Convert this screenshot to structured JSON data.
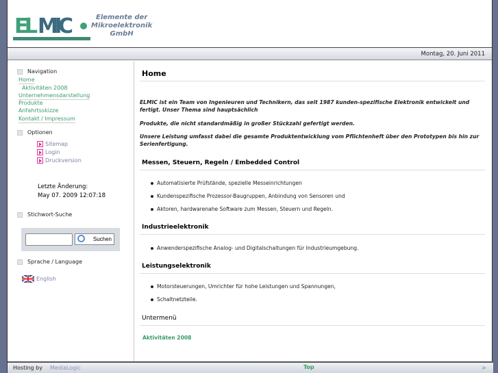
{
  "header": {
    "logo": "ELMIC",
    "tagline": [
      "Elemente der",
      "Mikroelektronik",
      "GmbH"
    ],
    "date": "Montag, 20. Juni 2011"
  },
  "sidebar": {
    "navigation_title": "Navigation",
    "nav": [
      "Home",
      "Aktivitäten 2008",
      "Unternehmensdarstellung",
      "Produkte",
      "Anfahrtsskizze",
      "Kontakt / Impressum"
    ],
    "options_title": "Optionen",
    "options": [
      "Sitemap",
      "Login",
      "Druckversion"
    ],
    "last_change_label": "Letzte Änderung:",
    "last_change": "May 07. 2009 12:07:18",
    "search_title": "Stichwort-Suche",
    "search_value": "",
    "search_button": "Suchen",
    "language_title": "Sprache / Language",
    "language": "English"
  },
  "main": {
    "title": "Home",
    "intro": [
      "ELMIC ist ein Team von Ingenieuren und Technikern, das seit 1987 kunden-spezifische Elektronik entwickelt und fertigt. Unser Thema sind hauptsächlich",
      "Produkte, die nicht standardmäßig in großer Stückzahl gefertigt werden.",
      "Unsere Leistung umfasst dabei die gesamte Produktentwicklung vom Pflichtenheft über den Prototypen bis hin zur Serienfertigung."
    ],
    "sections": [
      {
        "title": "Messen, Steuern, Regeln / Embedded Control",
        "items": [
          "Automatisierte Prüfstände, spezielle Messeinrichtungen",
          "Kundenspezifische Prozessor-Baugruppen, Anbindung von Sensoren und",
          "Aktoren, hardwarenahe Software zum Messen, Steuern und Regeln."
        ]
      },
      {
        "title": "Industrieelektronik",
        "items": [
          "Anwenderspezifische Analog- und Digitalschaltungen für Industrieumgebung."
        ]
      },
      {
        "title": "Leistungselektronik",
        "items": [
          "Motorsteuerungen, Umrichter für hohe Leistungen und Spannungen,",
          "Schaltnetzteile."
        ]
      }
    ],
    "submenu_title": "Untermenü",
    "submenu_link": "Aktivitäten 2008"
  },
  "footer": {
    "hosting": "Hosting by",
    "host": "MediaLogic",
    "top": "Top",
    "next": ">"
  }
}
